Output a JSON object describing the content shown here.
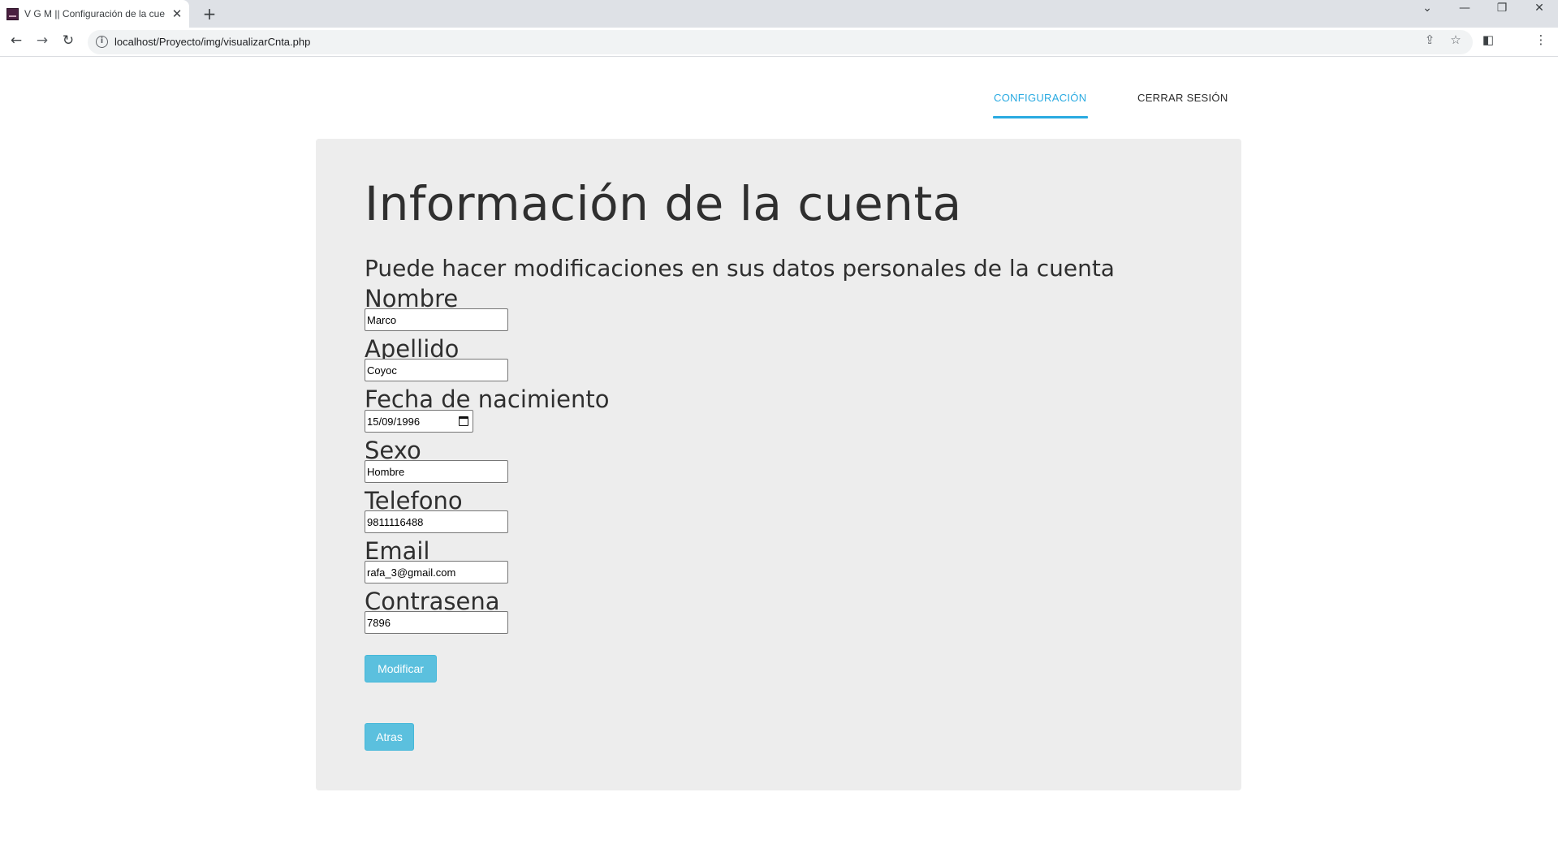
{
  "browser": {
    "tab_title": "V G M || Configuración de la cue",
    "url": "localhost/Proyecto/img/visualizarCnta.php"
  },
  "nav": {
    "config_label": "CONFIGURACIÓN",
    "logout_label": "CERRAR SESIÓN",
    "active": "config"
  },
  "account": {
    "title": "Información de la cuenta",
    "subtitle": "Puede hacer modificaciones en sus datos personales de la cuenta",
    "fields": {
      "nombre": {
        "label": "Nombre",
        "value": "Marco"
      },
      "apellido": {
        "label": "Apellido",
        "value": "Coyoc"
      },
      "fecha": {
        "label": "Fecha de nacimiento",
        "value": "15/09/1996"
      },
      "sexo": {
        "label": "Sexo",
        "value": "Hombre"
      },
      "telefono": {
        "label": "Telefono",
        "value": "9811116488"
      },
      "email": {
        "label": "Email",
        "value": "rafa_3@gmail.com"
      },
      "contrasena": {
        "label": "Contrasena",
        "value": "7896"
      }
    },
    "modify_label": "Modificar",
    "back_label": "Atras"
  },
  "colors": {
    "accent": "#29aae1",
    "button": "#5bc0de",
    "card_bg": "#ededed",
    "text": "#2f2f2f"
  }
}
